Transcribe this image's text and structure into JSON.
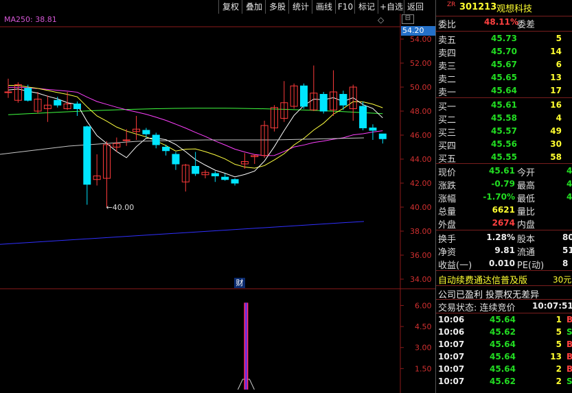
{
  "toolbar": {
    "buttons": [
      "复权",
      "叠加",
      "多股",
      "统计",
      "画线",
      "F10",
      "标记",
      "+自选",
      "返回"
    ]
  },
  "chart": {
    "ma_label": "MA250: 38.81",
    "current_price_tag": "54.20",
    "low_annotation": "←40.00",
    "finance_badge": "财",
    "price_axis": [
      "54.00",
      "52.00",
      "50.00",
      "48.00",
      "46.00",
      "44.00",
      "42.00",
      "40.00",
      "38.00",
      "36.00",
      "34.00"
    ],
    "volume_axis": [
      "6.00",
      "4.50",
      "3.00",
      "1.50"
    ],
    "colors": {
      "up": "#ff3b3b",
      "down": "#00e5ff",
      "ma5": "#ffffff",
      "ma10": "#ffff40",
      "ma20": "#ff40ff",
      "ma60": "#40ff40",
      "ma250": "#3030ff"
    }
  },
  "chart_data": {
    "type": "candlestick",
    "y_range": [
      34,
      54
    ],
    "candles": [
      {
        "o": 49.6,
        "c": 49.6,
        "h": 50.7,
        "l": 49.1
      },
      {
        "o": 48.9,
        "c": 50.2,
        "h": 50.4,
        "l": 48.7
      },
      {
        "o": 49.9,
        "c": 48.9,
        "h": 50.2,
        "l": 48.8
      },
      {
        "o": 48.0,
        "c": 49.0,
        "h": 49.6,
        "l": 47.8
      },
      {
        "o": 48.2,
        "c": 48.5,
        "h": 49.3,
        "l": 47.1
      },
      {
        "o": 48.9,
        "c": 48.5,
        "h": 49.2,
        "l": 48.3
      },
      {
        "o": 48.2,
        "c": 48.6,
        "h": 49.6,
        "l": 48.1
      },
      {
        "o": 48.6,
        "c": 48.2,
        "h": 48.8,
        "l": 47.6
      },
      {
        "o": 46.7,
        "c": 41.9,
        "h": 46.8,
        "l": 40.2
      },
      {
        "o": 42.3,
        "c": 42.6,
        "h": 44.4,
        "l": 41.8
      },
      {
        "o": 42.4,
        "c": 45.2,
        "h": 45.5,
        "l": 40.0
      },
      {
        "o": 45.0,
        "c": 45.3,
        "h": 45.8,
        "l": 44.6
      },
      {
        "o": 45.6,
        "c": 45.6,
        "h": 46.5,
        "l": 45.1
      },
      {
        "o": 46.3,
        "c": 46.5,
        "h": 47.6,
        "l": 45.6
      },
      {
        "o": 46.4,
        "c": 46.1,
        "h": 46.6,
        "l": 45.8
      },
      {
        "o": 46.0,
        "c": 45.2,
        "h": 46.2,
        "l": 44.9
      },
      {
        "o": 45.0,
        "c": 44.7,
        "h": 45.2,
        "l": 44.3
      },
      {
        "o": 44.4,
        "c": 43.6,
        "h": 44.6,
        "l": 43.1
      },
      {
        "o": 42.1,
        "c": 43.5,
        "h": 43.6,
        "l": 41.3
      },
      {
        "o": 43.4,
        "c": 42.8,
        "h": 44.6,
        "l": 42.6
      },
      {
        "o": 42.7,
        "c": 42.9,
        "h": 43.1,
        "l": 42.4
      },
      {
        "o": 42.8,
        "c": 42.6,
        "h": 43.0,
        "l": 42.1
      },
      {
        "o": 42.5,
        "c": 42.3,
        "h": 42.8,
        "l": 42.2
      },
      {
        "o": 42.3,
        "c": 42.0,
        "h": 42.4,
        "l": 41.8
      },
      {
        "o": 43.6,
        "c": 43.8,
        "h": 44.5,
        "l": 43.2
      },
      {
        "o": 44.2,
        "c": 44.3,
        "h": 44.4,
        "l": 43.6
      },
      {
        "o": 44.3,
        "c": 46.8,
        "h": 47.2,
        "l": 44.1
      },
      {
        "o": 46.6,
        "c": 48.3,
        "h": 48.5,
        "l": 46.3
      },
      {
        "o": 47.4,
        "c": 48.7,
        "h": 50.5,
        "l": 47.1
      },
      {
        "o": 48.4,
        "c": 50.1,
        "h": 50.3,
        "l": 48.2
      },
      {
        "o": 50.1,
        "c": 48.4,
        "h": 50.3,
        "l": 48.2
      },
      {
        "o": 48.1,
        "c": 49.5,
        "h": 51.8,
        "l": 48.0
      },
      {
        "o": 49.4,
        "c": 48.0,
        "h": 49.6,
        "l": 47.8
      },
      {
        "o": 48.1,
        "c": 49.6,
        "h": 51.4,
        "l": 47.6
      },
      {
        "o": 49.4,
        "c": 48.5,
        "h": 49.7,
        "l": 48.1
      },
      {
        "o": 48.2,
        "c": 50.0,
        "h": 50.2,
        "l": 47.2
      },
      {
        "o": 48.4,
        "c": 46.6,
        "h": 48.8,
        "l": 46.4
      },
      {
        "o": 46.6,
        "c": 46.4,
        "h": 46.9,
        "l": 45.6
      },
      {
        "o": 46.1,
        "c": 45.7,
        "h": 46.1,
        "l": 45.3
      }
    ],
    "volume_range": [
      0,
      7
    ],
    "volume_spike": {
      "index": 24,
      "value": 6.2
    }
  },
  "quote": {
    "prefix": "ZR",
    "code": "301213",
    "name": "观想科技",
    "weibi_label": "委比",
    "weibi_value": "48.11%",
    "weicha_label": "委差",
    "sells": [
      {
        "label": "卖五",
        "price": "45.73",
        "vol": "5"
      },
      {
        "label": "卖四",
        "price": "45.70",
        "vol": "14"
      },
      {
        "label": "卖三",
        "price": "45.67",
        "vol": "6"
      },
      {
        "label": "卖二",
        "price": "45.65",
        "vol": "13"
      },
      {
        "label": "卖一",
        "price": "45.64",
        "vol": "17"
      }
    ],
    "buys": [
      {
        "label": "买一",
        "price": "45.61",
        "vol": "16"
      },
      {
        "label": "买二",
        "price": "45.58",
        "vol": "4"
      },
      {
        "label": "买三",
        "price": "45.57",
        "vol": "49"
      },
      {
        "label": "买四",
        "price": "45.56",
        "vol": "30"
      },
      {
        "label": "买五",
        "price": "45.55",
        "vol": "58"
      }
    ],
    "stats1": [
      {
        "l1": "现价",
        "v1": "45.61",
        "c1": "green",
        "l2": "今开",
        "v2": "4"
      },
      {
        "l1": "涨跌",
        "v1": "-0.79",
        "c1": "green",
        "l2": "最高",
        "v2": "4"
      },
      {
        "l1": "涨幅",
        "v1": "-1.70%",
        "c1": "green",
        "l2": "最低",
        "v2": "4"
      },
      {
        "l1": "总量",
        "v1": "6621",
        "c1": "yellow",
        "l2": "量比",
        "v2": ""
      },
      {
        "l1": "外盘",
        "v1": "2674",
        "c1": "red",
        "l2": "内盘",
        "v2": ""
      }
    ],
    "stats2": [
      {
        "l1": "换手",
        "v1": "1.28%",
        "l2": "股本",
        "v2": "80"
      },
      {
        "l1": "净资",
        "v1": "9.81",
        "l2": "流通",
        "v2": "51"
      },
      {
        "l1": "收益(一)",
        "v1": "0.010",
        "l2": "PE(动)",
        "v2": "8"
      }
    ],
    "promo": "自动续费通达信普及版",
    "promo_price": "30元",
    "notice": "公司已盈利 投票权无差异",
    "trade_status": "交易状态: 连续竞价",
    "trade_time": "10:07:51",
    "ticks": [
      {
        "time": "10:06",
        "price": "45.64",
        "vol": "1",
        "side": "B",
        "sc": "red"
      },
      {
        "time": "10:06",
        "price": "45.62",
        "vol": "5",
        "side": "S",
        "sc": "green"
      },
      {
        "time": "10:07",
        "price": "45.64",
        "vol": "5",
        "side": "B",
        "sc": "red"
      },
      {
        "time": "10:07",
        "price": "45.64",
        "vol": "13",
        "side": "B",
        "sc": "red"
      },
      {
        "time": "10:07",
        "price": "45.64",
        "vol": "2",
        "side": "B",
        "sc": "red"
      },
      {
        "time": "10:07",
        "price": "45.62",
        "vol": "2",
        "side": "S",
        "sc": "green"
      }
    ]
  }
}
